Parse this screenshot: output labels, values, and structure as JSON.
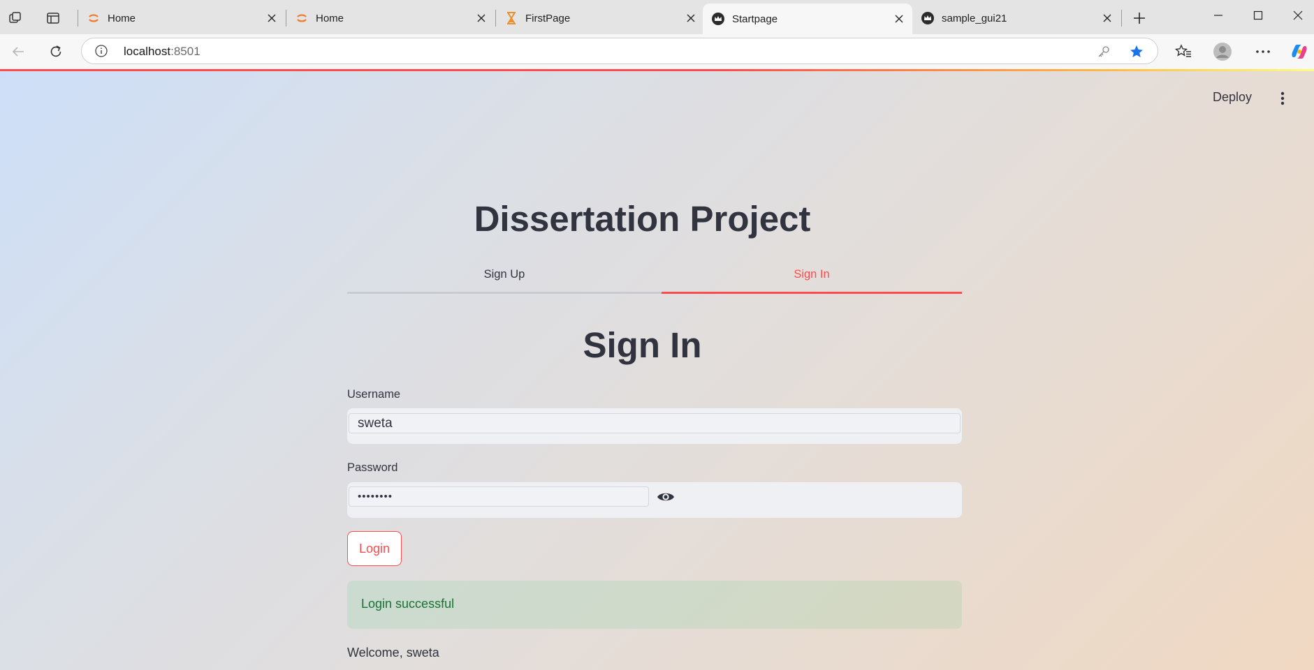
{
  "browser": {
    "tabs": [
      {
        "title": "Home",
        "icon": "jupyter-icon",
        "active": false
      },
      {
        "title": "Home",
        "icon": "jupyter-icon",
        "active": false
      },
      {
        "title": "FirstPage",
        "icon": "hourglass-icon",
        "active": false
      },
      {
        "title": "Startpage",
        "icon": "streamlit-crown-icon",
        "active": true
      },
      {
        "title": "sample_gui21",
        "icon": "streamlit-crown-icon",
        "active": false
      }
    ],
    "address": {
      "host": "localhost",
      "port": ":8501"
    },
    "colors": {
      "favorite_star": "#1a73e8",
      "jupyter": "#f37726",
      "hourglass": "#e8912d"
    }
  },
  "app": {
    "deploy_label": "Deploy",
    "title": "Dissertation Project",
    "tabs": [
      {
        "label": "Sign Up",
        "active": false
      },
      {
        "label": "Sign In",
        "active": true
      }
    ],
    "signin": {
      "header": "Sign In",
      "username_label": "Username",
      "username_value": "sweta",
      "password_label": "Password",
      "password_value": "••••••••",
      "login_button": "Login",
      "success_message": "Login successful",
      "welcome_text": "Welcome, sweta"
    },
    "colors": {
      "primary": "#ff4b4b",
      "text": "#31333f",
      "success_text": "#177233"
    }
  }
}
